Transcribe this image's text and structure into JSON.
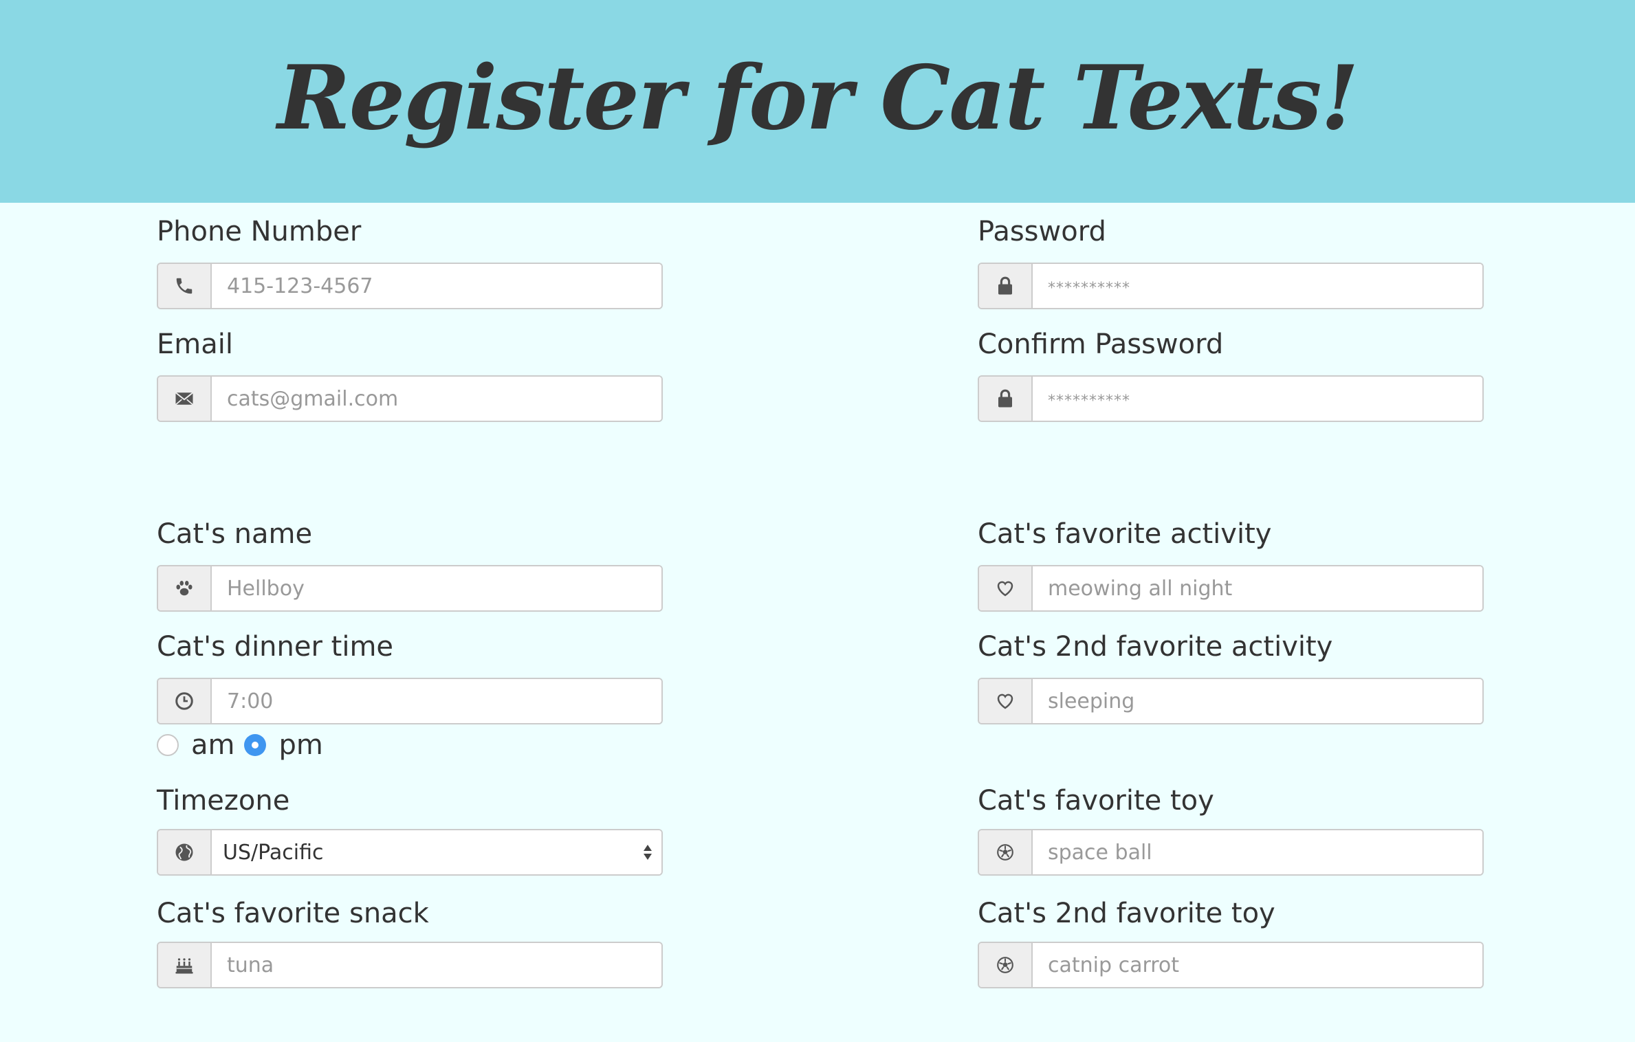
{
  "header": {
    "title": "Register for Cat Texts!"
  },
  "form": {
    "phone": {
      "label": "Phone Number",
      "placeholder": "415-123-4567",
      "icon": "phone-icon"
    },
    "email": {
      "label": "Email",
      "placeholder": "cats@gmail.com",
      "icon": "envelope-icon"
    },
    "password": {
      "label": "Password",
      "placeholder": "**********",
      "icon": "lock-icon"
    },
    "confirm_password": {
      "label": "Confirm Password",
      "placeholder": "**********",
      "icon": "lock-icon"
    },
    "cat_name": {
      "label": "Cat's name",
      "placeholder": "Hellboy",
      "icon": "paw-icon"
    },
    "dinner_time": {
      "label": "Cat's dinner time",
      "placeholder": "7:00",
      "icon": "clock-icon",
      "am_label": "am",
      "pm_label": "pm",
      "selected": "pm"
    },
    "timezone": {
      "label": "Timezone",
      "value": "US/Pacific",
      "icon": "globe-icon"
    },
    "favorite_snack": {
      "label": "Cat's favorite snack",
      "placeholder": "tuna",
      "icon": "cake-icon"
    },
    "favorite_activity": {
      "label": "Cat's favorite activity",
      "placeholder": "meowing all night",
      "icon": "heart-icon"
    },
    "second_activity": {
      "label": "Cat's 2nd favorite activity",
      "placeholder": "sleeping",
      "icon": "heart-icon"
    },
    "favorite_toy": {
      "label": "Cat's favorite toy",
      "placeholder": "space ball",
      "icon": "soccer-ball-icon"
    },
    "second_toy": {
      "label": "Cat's 2nd favorite toy",
      "placeholder": "catnip carrot",
      "icon": "soccer-ball-icon"
    }
  },
  "colors": {
    "header_bg": "#8ad8e4",
    "page_bg": "#eeffff",
    "radio_accent": "#3f96f0"
  }
}
